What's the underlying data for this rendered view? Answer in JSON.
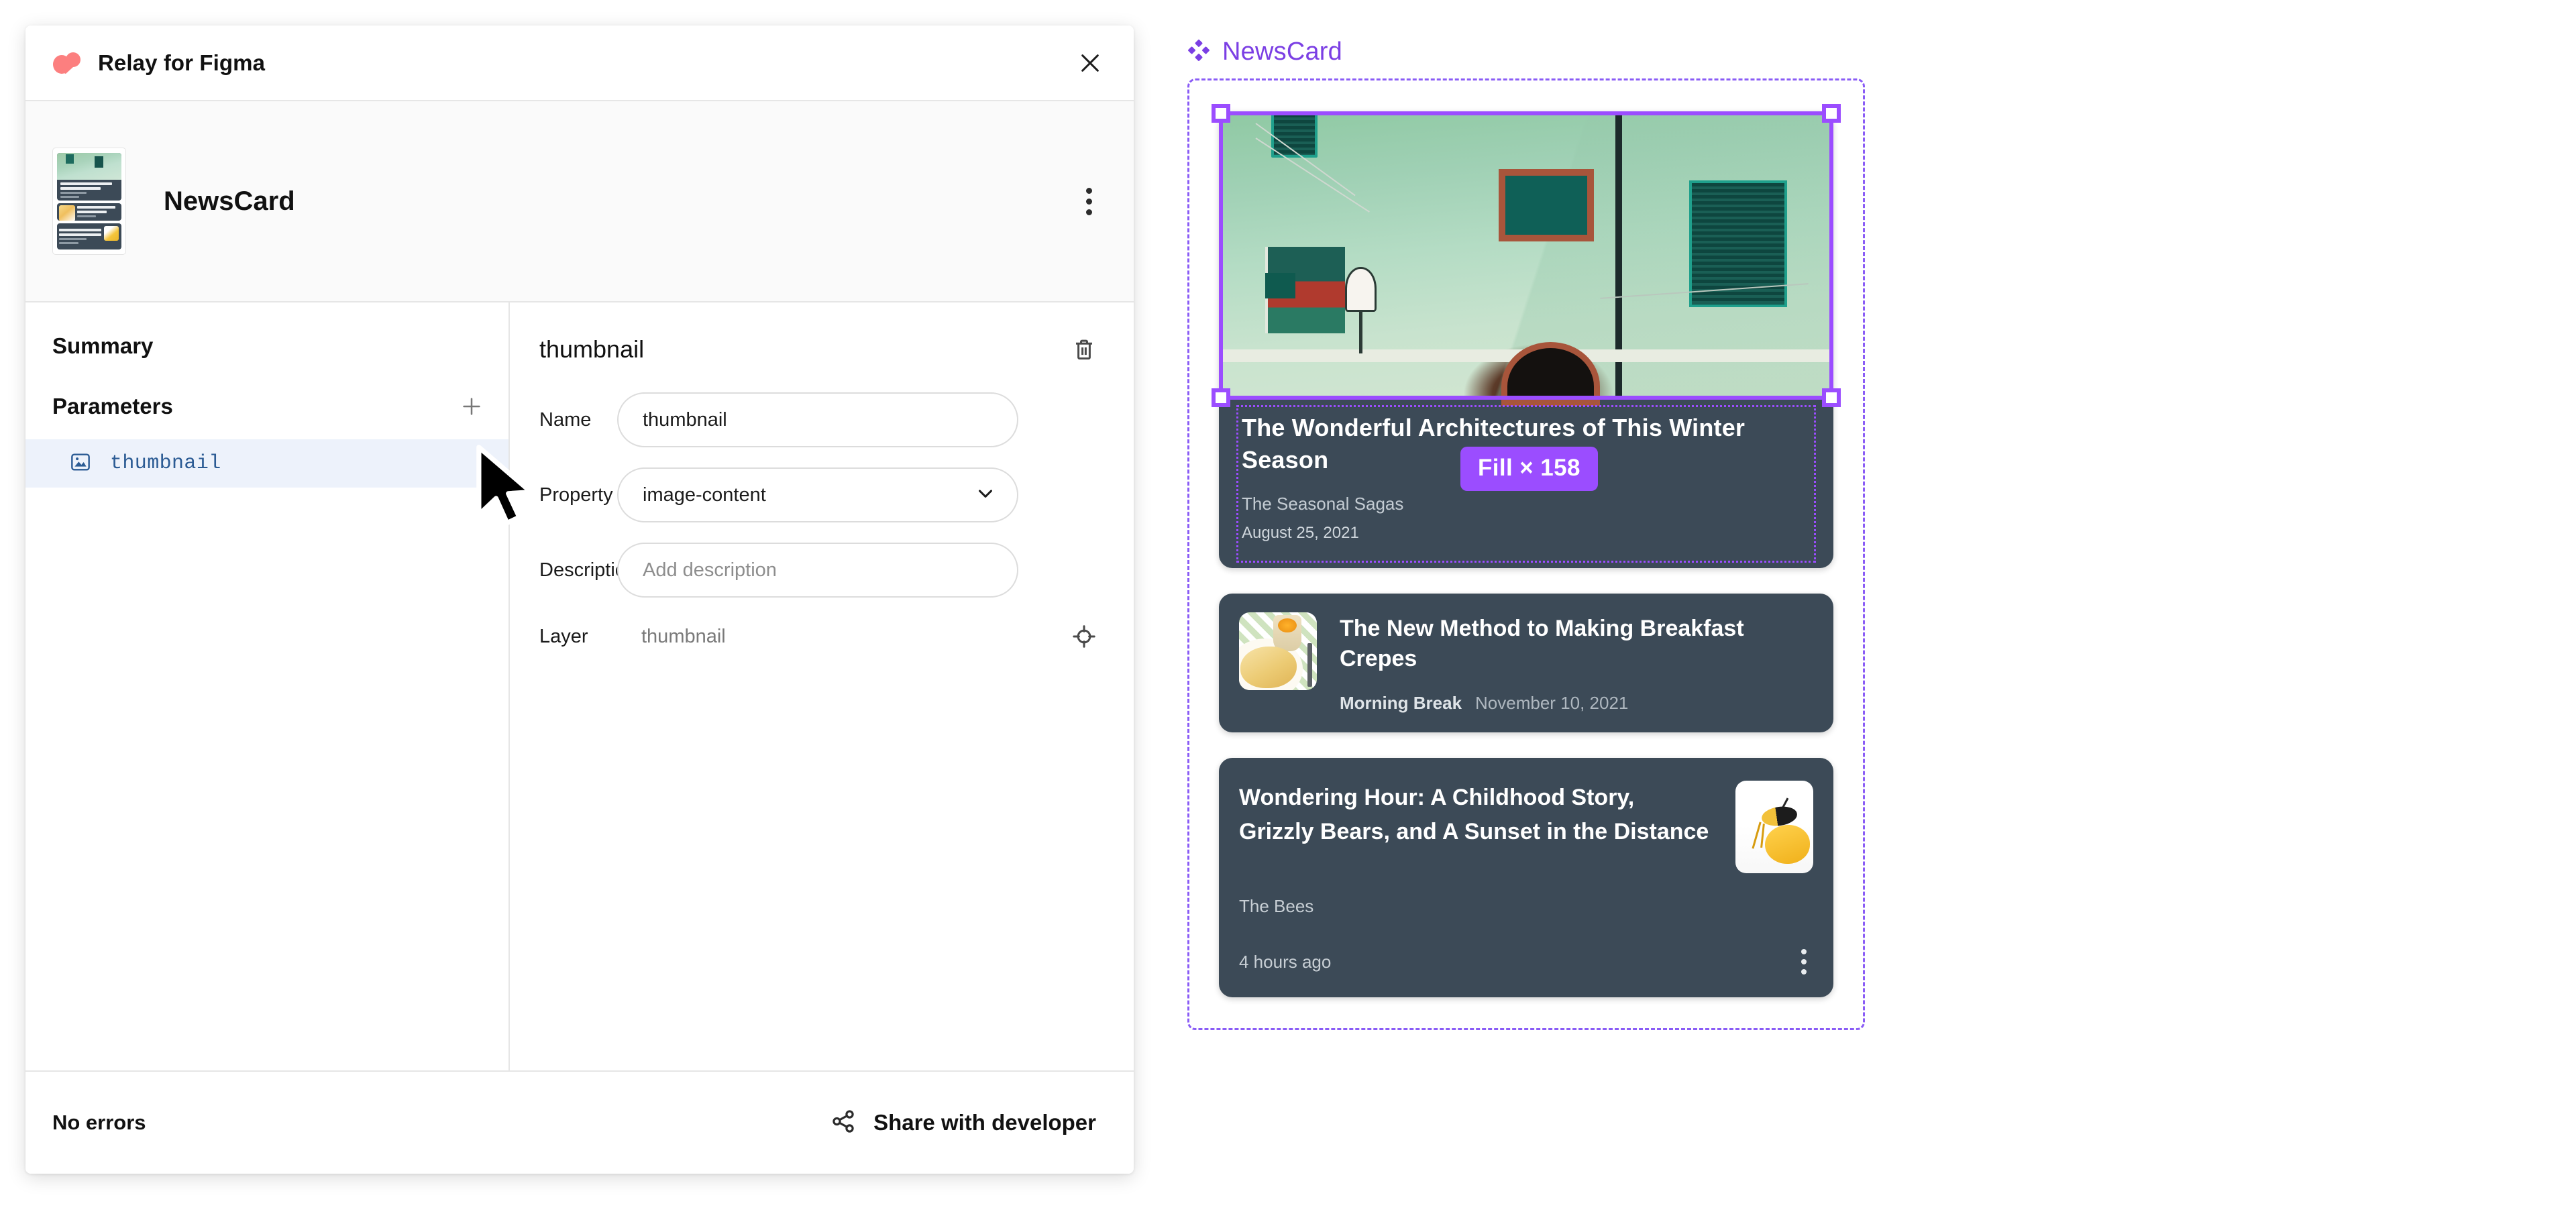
{
  "plugin": {
    "titlebar": {
      "logo_icon": "relay-logo",
      "title": "Relay for Figma",
      "close_icon": "close-icon"
    },
    "component_header": {
      "thumbnail_icon": "component-preview-thumbnail",
      "title": "NewsCard",
      "menu_icon": "kebab-menu-icon"
    },
    "left_panel": {
      "summary_label": "Summary",
      "parameters_label": "Parameters",
      "add_icon": "plus-icon",
      "parameters": [
        {
          "icon": "image-parameter-icon",
          "label": "thumbnail",
          "selected": true
        }
      ]
    },
    "detail_panel": {
      "title": "thumbnail",
      "delete_icon": "trash-icon",
      "fields": [
        {
          "label": "Name",
          "value": "thumbnail",
          "placeholder": "Name",
          "type": "text"
        },
        {
          "label": "Property",
          "value": "image-content",
          "placeholder": "Property",
          "type": "select",
          "chevron_icon": "chevron-down-icon"
        },
        {
          "label": "Description",
          "value": "",
          "placeholder": "Add description",
          "type": "text"
        }
      ],
      "layer": {
        "label": "Layer",
        "value": "thumbnail",
        "locate_icon": "target-crosshair-icon"
      }
    },
    "footer": {
      "status": "No errors",
      "share_icon": "share-icon",
      "share_label": "Share with developer"
    }
  },
  "canvas": {
    "frame": {
      "badge_icon": "component-diamond-icon",
      "name": "NewsCard",
      "accent_color": "#7b3fe4",
      "selection_color": "#9b4dff",
      "card_background": "#3c4a57"
    },
    "selection_badge": {
      "text": "Fill × 158"
    },
    "cards": [
      {
        "title": "The Wonderful Architectures of This Winter Season",
        "source": "The Seasonal Sagas",
        "date": "August 25, 2021",
        "image_icon": "green-building-photo",
        "layout": "hero",
        "selected": true
      },
      {
        "title": "The New Method to Making Breakfast Crepes",
        "source": "Morning Break",
        "date": "November 10, 2021",
        "image_icon": "crepes-photo",
        "layout": "thumbnail-left"
      },
      {
        "title": "Wondering Hour: A Childhood Story, Grizzly Bears, and A Sunset in the Distance",
        "source": "The Bees",
        "date": "4 hours ago",
        "image_icon": "bee-photo",
        "layout": "thumbnail-right",
        "menu_icon": "kebab-menu-icon"
      }
    ]
  },
  "cursor": {
    "icon": "mouse-pointer-arrow"
  }
}
